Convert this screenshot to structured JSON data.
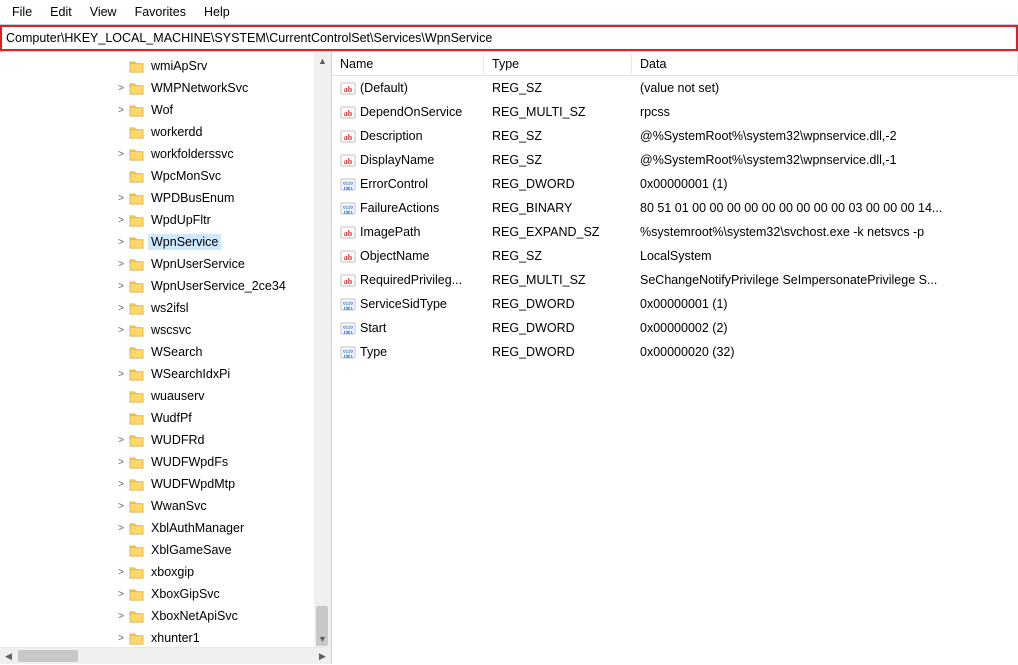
{
  "menu": {
    "file": "File",
    "edit": "Edit",
    "view": "View",
    "favorites": "Favorites",
    "help": "Help"
  },
  "address": "Computer\\HKEY_LOCAL_MACHINE\\SYSTEM\\CurrentControlSet\\Services\\WpnService",
  "tree": {
    "items": [
      {
        "label": "wmiApSrv",
        "expander": ""
      },
      {
        "label": "WMPNetworkSvc",
        "expander": ">"
      },
      {
        "label": "Wof",
        "expander": ">"
      },
      {
        "label": "workerdd",
        "expander": ""
      },
      {
        "label": "workfolderssvc",
        "expander": ">"
      },
      {
        "label": "WpcMonSvc",
        "expander": ""
      },
      {
        "label": "WPDBusEnum",
        "expander": ">"
      },
      {
        "label": "WpdUpFltr",
        "expander": ">"
      },
      {
        "label": "WpnService",
        "expander": ">",
        "selected": true
      },
      {
        "label": "WpnUserService",
        "expander": ">"
      },
      {
        "label": "WpnUserService_2ce34",
        "expander": ">"
      },
      {
        "label": "ws2ifsl",
        "expander": ">"
      },
      {
        "label": "wscsvc",
        "expander": ">"
      },
      {
        "label": "WSearch",
        "expander": ""
      },
      {
        "label": "WSearchIdxPi",
        "expander": ">"
      },
      {
        "label": "wuauserv",
        "expander": ""
      },
      {
        "label": "WudfPf",
        "expander": ""
      },
      {
        "label": "WUDFRd",
        "expander": ">"
      },
      {
        "label": "WUDFWpdFs",
        "expander": ">"
      },
      {
        "label": "WUDFWpdMtp",
        "expander": ">"
      },
      {
        "label": "WwanSvc",
        "expander": ">"
      },
      {
        "label": "XblAuthManager",
        "expander": ">"
      },
      {
        "label": "XblGameSave",
        "expander": ""
      },
      {
        "label": "xboxgip",
        "expander": ">"
      },
      {
        "label": "XboxGipSvc",
        "expander": ">"
      },
      {
        "label": "XboxNetApiSvc",
        "expander": ">"
      },
      {
        "label": "xhunter1",
        "expander": ">"
      }
    ]
  },
  "values": {
    "headers": {
      "name": "Name",
      "type": "Type",
      "data": "Data"
    },
    "rows": [
      {
        "icon": "string",
        "name": "(Default)",
        "type": "REG_SZ",
        "data": "(value not set)"
      },
      {
        "icon": "string",
        "name": "DependOnService",
        "type": "REG_MULTI_SZ",
        "data": "rpcss"
      },
      {
        "icon": "string",
        "name": "Description",
        "type": "REG_SZ",
        "data": "@%SystemRoot%\\system32\\wpnservice.dll,-2"
      },
      {
        "icon": "string",
        "name": "DisplayName",
        "type": "REG_SZ",
        "data": "@%SystemRoot%\\system32\\wpnservice.dll,-1"
      },
      {
        "icon": "binary",
        "name": "ErrorControl",
        "type": "REG_DWORD",
        "data": "0x00000001 (1)"
      },
      {
        "icon": "binary",
        "name": "FailureActions",
        "type": "REG_BINARY",
        "data": "80 51 01 00 00 00 00 00 00 00 00 00 03 00 00 00 14..."
      },
      {
        "icon": "string",
        "name": "ImagePath",
        "type": "REG_EXPAND_SZ",
        "data": "%systemroot%\\system32\\svchost.exe -k netsvcs -p"
      },
      {
        "icon": "string",
        "name": "ObjectName",
        "type": "REG_SZ",
        "data": "LocalSystem"
      },
      {
        "icon": "string",
        "name": "RequiredPrivileg...",
        "type": "REG_MULTI_SZ",
        "data": "SeChangeNotifyPrivilege SeImpersonatePrivilege S..."
      },
      {
        "icon": "binary",
        "name": "ServiceSidType",
        "type": "REG_DWORD",
        "data": "0x00000001 (1)"
      },
      {
        "icon": "binary",
        "name": "Start",
        "type": "REG_DWORD",
        "data": "0x00000002 (2)"
      },
      {
        "icon": "binary",
        "name": "Type",
        "type": "REG_DWORD",
        "data": "0x00000020 (32)"
      }
    ]
  }
}
